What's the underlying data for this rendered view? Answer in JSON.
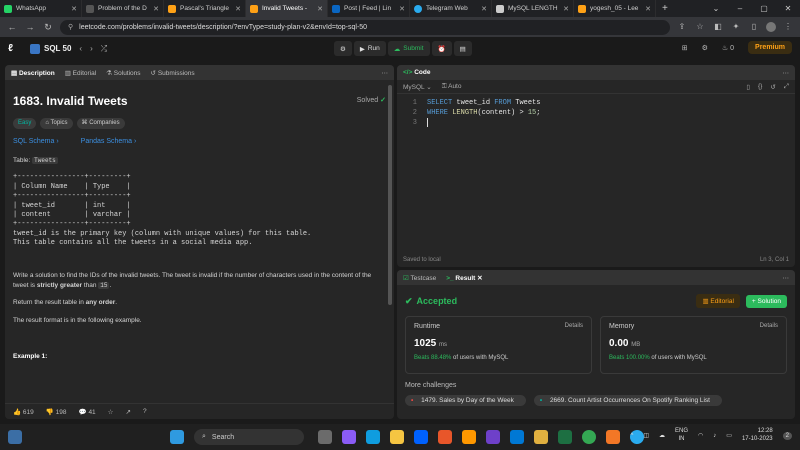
{
  "browser": {
    "tabs": [
      {
        "title": "WhatsApp",
        "color": "#25d366"
      },
      {
        "title": "Problem of the D",
        "color": "#ffffff"
      },
      {
        "title": "Pascal's Triangle",
        "color": "#ffa116"
      },
      {
        "title": "Invalid Tweets -",
        "color": "#ffa116"
      },
      {
        "title": "Post | Feed | Lin",
        "color": "#0a66c2"
      },
      {
        "title": "Telegram Web",
        "color": "#2aabee"
      },
      {
        "title": "MySQL LENGTH",
        "color": "#cccccc"
      },
      {
        "title": "yogesh_05 - Lee",
        "color": "#ffa116"
      }
    ],
    "url": "leetcode.com/problems/invalid-tweets/description/?envType=study-plan-v2&envId=top-sql-50"
  },
  "lc": {
    "list_name": "SQL 50",
    "run_label": "Run",
    "submit_label": "Submit",
    "streak": "0",
    "premium_label": "Premium"
  },
  "description": {
    "tabs": [
      "Description",
      "Editorial",
      "Solutions",
      "Submissions"
    ],
    "title": "1683. Invalid Tweets",
    "solved_label": "Solved",
    "chips": [
      "Easy",
      "Topics",
      "Companies"
    ],
    "links": [
      "SQL Schema",
      "Pandas Schema"
    ],
    "table_label": "Table:",
    "table_name": "Tweets",
    "schema": "+----------------+---------+\n| Column Name    | Type    |\n+----------------+---------+\n| tweet_id       | int     |\n| content        | varchar |\n+----------------+---------+\ntweet_id is the primary key (column with unique values) for this table.\nThis table contains all the tweets in a social media app.",
    "para1_a": "Write a solution to find the IDs of the invalid tweets. The tweet is invalid if the number of characters used in the content of the tweet is ",
    "para1_b": "strictly greater",
    "para1_c": " than ",
    "para1_num": "15",
    "para1_end": ".",
    "para2_a": "Return the result table in ",
    "para2_b": "any order",
    "para2_c": ".",
    "para3": "The result format is in the following example.",
    "example_label": "Example 1:",
    "likes": "619",
    "dislikes": "198",
    "comments": "41"
  },
  "code": {
    "tab_label": "Code",
    "lang": "MySQL",
    "auto": "Auto",
    "lines": [
      {
        "n": "1",
        "t": "SELECT tweet_id FROM Tweets"
      },
      {
        "n": "2",
        "t": "WHERE LENGTH(content) > 15;"
      },
      {
        "n": "3",
        "t": ""
      }
    ],
    "saved": "Saved to local",
    "cursor": "Ln 3, Col 1"
  },
  "result": {
    "tabs": [
      "Testcase",
      "Result"
    ],
    "status": "Accepted",
    "editorial": "Editorial",
    "solution": "Solution",
    "runtime_label": "Runtime",
    "runtime_value": "1025",
    "runtime_unit": "ms",
    "runtime_beats": "Beats 88.48%",
    "runtime_suffix": "of users with MySQL",
    "memory_label": "Memory",
    "memory_value": "0.00",
    "memory_unit": "MB",
    "memory_beats": "Beats 100.00%",
    "memory_suffix": "of users with MySQL",
    "details": "Details",
    "more_label": "More challenges",
    "challenges": [
      "1479. Sales by Day of the Week",
      "2669. Count Artist Occurrences On Spotify Ranking List"
    ]
  },
  "taskbar": {
    "search": "Search",
    "lang1": "ENG",
    "lang2": "IN",
    "time": "12:28",
    "date": "17-10-2023"
  }
}
